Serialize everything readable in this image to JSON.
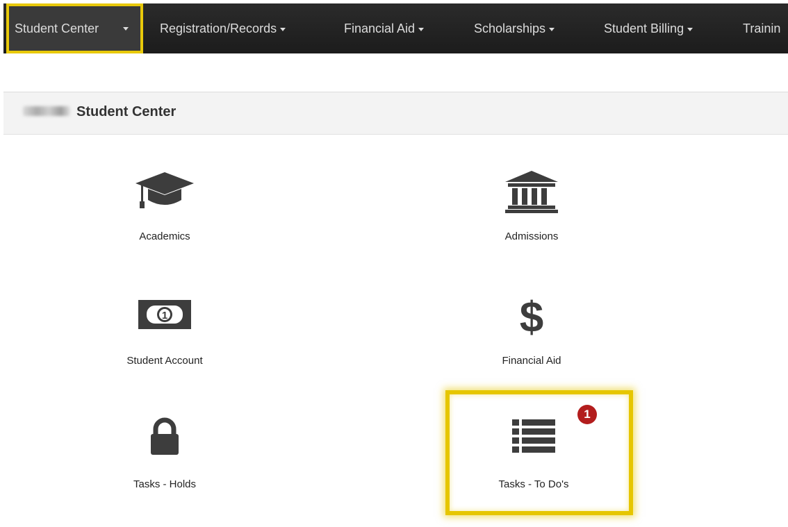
{
  "nav": {
    "items": [
      {
        "label": "Student Center",
        "active": true
      },
      {
        "label": "Registration/Records"
      },
      {
        "label": "Financial Aid"
      },
      {
        "label": "Scholarships"
      },
      {
        "label": "Student Billing"
      },
      {
        "label": "Trainin"
      }
    ]
  },
  "header": {
    "title": "Student Center"
  },
  "tiles": [
    {
      "label": "Academics",
      "icon": "graduation-cap-icon"
    },
    {
      "label": "Admissions",
      "icon": "institution-icon"
    },
    {
      "label": "Student Account",
      "icon": "money-bill-icon"
    },
    {
      "label": "Financial Aid",
      "icon": "dollar-icon"
    },
    {
      "label": "Tasks - Holds",
      "icon": "lock-icon"
    },
    {
      "label": "Tasks - To Do's",
      "icon": "list-icon",
      "badge": "1"
    }
  ],
  "colors": {
    "highlight": "#e6c600",
    "badge": "#b31d1d",
    "icon": "#3d3d3d",
    "navbar": "#222222"
  }
}
